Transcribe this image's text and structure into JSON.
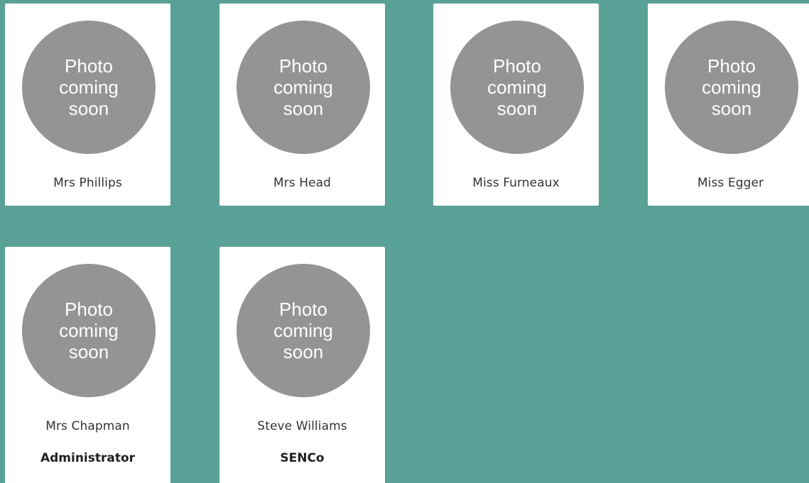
{
  "colors": {
    "background": "#59a096",
    "card": "#ffffff",
    "photo_placeholder": "#949494"
  },
  "staff": [
    {
      "photo_text": "Photo coming soon",
      "name": "Mrs Phillips",
      "role": ""
    },
    {
      "photo_text": "Photo coming soon",
      "name": "Mrs Head",
      "role": ""
    },
    {
      "photo_text": "Photo coming soon",
      "name": "Miss Furneaux",
      "role": ""
    },
    {
      "photo_text": "Photo coming soon",
      "name": "Miss Egger",
      "role": ""
    },
    {
      "photo_text": "Photo coming soon",
      "name": "Mrs Chapman",
      "role": "Administrator"
    },
    {
      "photo_text": "Photo coming soon",
      "name": "Steve Williams",
      "role": "SENCo"
    }
  ]
}
